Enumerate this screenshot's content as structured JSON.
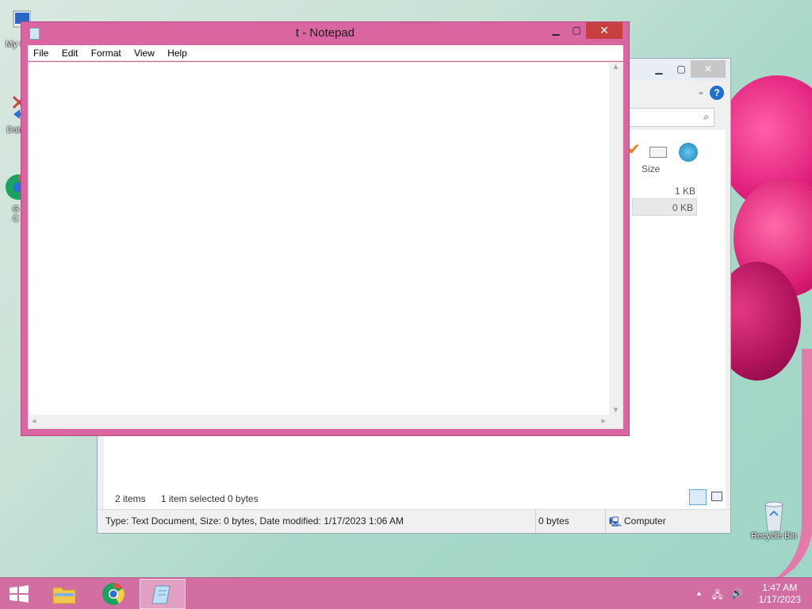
{
  "desktop": {
    "icons": [
      {
        "label": "My C"
      },
      {
        "label": "Data"
      },
      {
        "label": "G\nC"
      },
      {
        "label": "Recycle Bin"
      }
    ]
  },
  "explorer": {
    "column_size": "Size",
    "files": [
      {
        "size": "1 KB"
      },
      {
        "size": "0 KB"
      }
    ],
    "status": {
      "items": "2 items",
      "selected": "1 item selected  0 bytes"
    },
    "details": {
      "description": "Type: Text Document, Size: 0 bytes, Date modified: 1/17/2023 1:06 AM",
      "bytes": "0 bytes",
      "location": "Computer"
    }
  },
  "notepad": {
    "title": "t - Notepad",
    "menu": [
      "File",
      "Edit",
      "Format",
      "View",
      "Help"
    ],
    "content": ""
  },
  "taskbar": {
    "clock_time": "1:47 AM",
    "clock_date": "1/17/2023",
    "apps": [
      "file-explorer",
      "chrome",
      "notepad"
    ]
  },
  "colors": {
    "window_frame": "#d966a1",
    "taskbar": "#d36ea2",
    "close_button": "#c7403f"
  }
}
